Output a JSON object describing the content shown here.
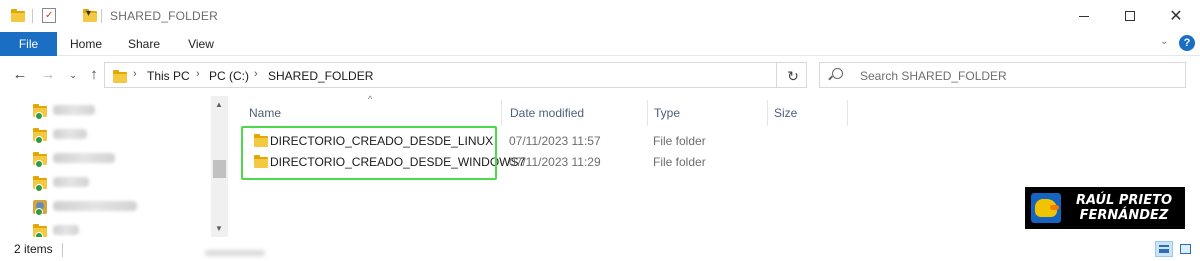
{
  "titlebar": {
    "title": "SHARED_FOLDER",
    "minimize_icon": "minimize-icon",
    "maximize_icon": "maximize-icon",
    "close_icon": "close-icon"
  },
  "ribbon": {
    "tabs": [
      {
        "label": "File",
        "active": true
      },
      {
        "label": "Home"
      },
      {
        "label": "Share"
      },
      {
        "label": "View"
      }
    ],
    "accent_color": "#1a6ec4"
  },
  "address": {
    "breadcrumbs": [
      "This PC",
      "PC (C:)",
      "SHARED_FOLDER"
    ]
  },
  "search": {
    "placeholder": "Search SHARED_FOLDER"
  },
  "navpane": {
    "items": [
      {
        "icon": "folder-icon",
        "blurred": true
      },
      {
        "icon": "folder-icon",
        "blurred": true
      },
      {
        "icon": "folder-icon",
        "blurred": true
      },
      {
        "icon": "folder-icon",
        "blurred": true
      },
      {
        "icon": "user-folder-icon",
        "blurred": true
      },
      {
        "icon": "folder-icon",
        "blurred": true
      }
    ]
  },
  "filelist": {
    "columns": [
      "Name",
      "Date modified",
      "Type",
      "Size"
    ],
    "rows": [
      {
        "name": "DIRECTORIO_CREADO_DESDE_LINUX",
        "date": "07/11/2023 11:57",
        "type": "File folder",
        "size": ""
      },
      {
        "name": "DIRECTORIO_CREADO_DESDE_WINDOWS7",
        "date": "07/11/2023 11:29",
        "type": "File folder",
        "size": ""
      }
    ],
    "highlight_color": "#4cd94c"
  },
  "badge": {
    "line1": "RAÚL PRIETO",
    "line2": "FERNÁNDEZ"
  },
  "statusbar": {
    "item_count": "2 items"
  }
}
